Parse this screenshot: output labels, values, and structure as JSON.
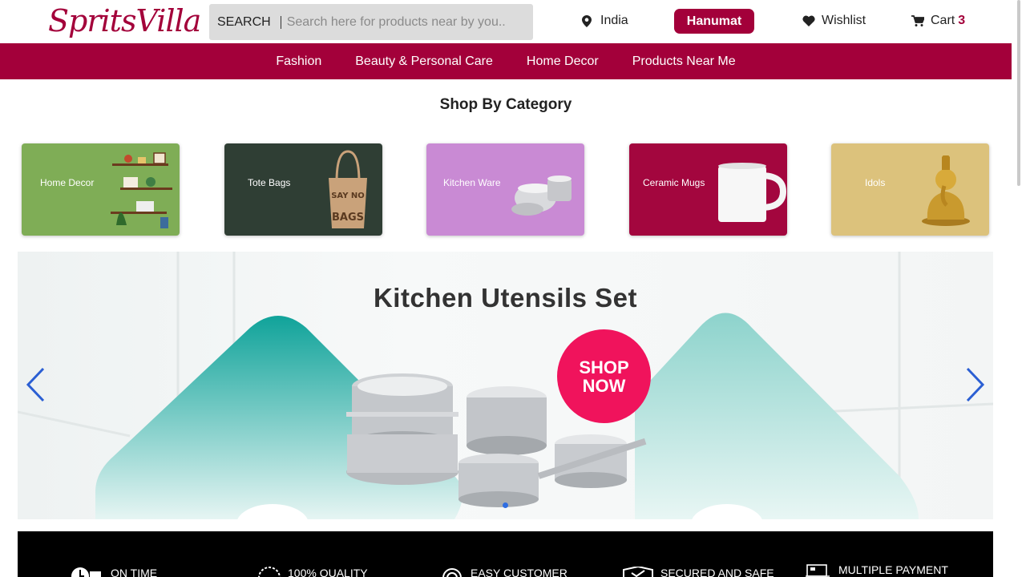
{
  "header": {
    "logo_text": "SpritsVilla",
    "search_label": "SEARCH",
    "search_placeholder": "Search here for products near by you..",
    "location": "India",
    "user_name": "Hanumat",
    "wishlist_label": "Wishlist",
    "cart_label": "Cart",
    "cart_count": "3"
  },
  "nav": {
    "items": [
      "Fashion",
      "Beauty & Personal Care",
      "Home Decor",
      "Products Near Me"
    ]
  },
  "categories": {
    "title": "Shop By Category",
    "items": [
      {
        "label": "Home Decor",
        "color": "#7fad56"
      },
      {
        "label": "Tote Bags",
        "color": "#2f3e34"
      },
      {
        "label": "Kitchen Ware",
        "color": "#c98ad4"
      },
      {
        "label": "Ceramic Mugs",
        "color": "#a3063e"
      },
      {
        "label": "Idols",
        "color": "#dcc27c"
      }
    ]
  },
  "banner": {
    "title": "Kitchen Utensils Set",
    "cta_line1": "SHOP",
    "cta_line2": "NOW",
    "accent": "#f0135c",
    "teal": "#12a79d"
  },
  "features": {
    "items": [
      "ON TIME",
      "100% QUALITY",
      "EASY CUSTOMER",
      "SECURED AND SAFE",
      "MULTIPLE PAYMENT"
    ]
  },
  "colors": {
    "brand": "#a3003a",
    "slider_arrow": "#2b5fd3"
  }
}
